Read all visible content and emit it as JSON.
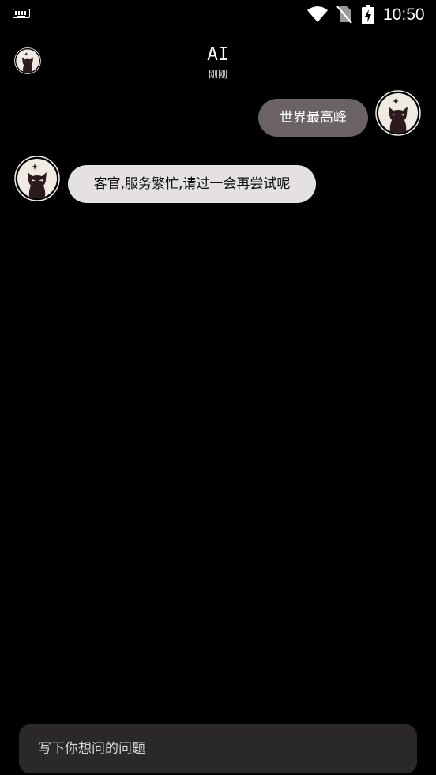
{
  "status_bar": {
    "time": "10:50",
    "icons": [
      "keyboard-icon",
      "wifi-icon",
      "no-sim-icon",
      "battery-charging-icon"
    ]
  },
  "header": {
    "title": "AI",
    "subtitle": "刚刚",
    "avatar_icon": "cat-avatar-icon"
  },
  "messages": [
    {
      "role": "user",
      "text": "世界最高峰",
      "avatar_icon": "cat-avatar-icon"
    },
    {
      "role": "ai",
      "text": "客官,服务繁忙,请过一会再尝试呢",
      "avatar_icon": "cat-avatar-icon"
    }
  ],
  "input": {
    "placeholder": "写下你想问的问题",
    "value": ""
  },
  "colors": {
    "background": "#000000",
    "user_bubble": "#6b6264",
    "ai_bubble": "#e5e1e2",
    "input_background": "#2a2828",
    "avatar_background": "#f0ebe2",
    "cat": "#2b1b1c"
  }
}
